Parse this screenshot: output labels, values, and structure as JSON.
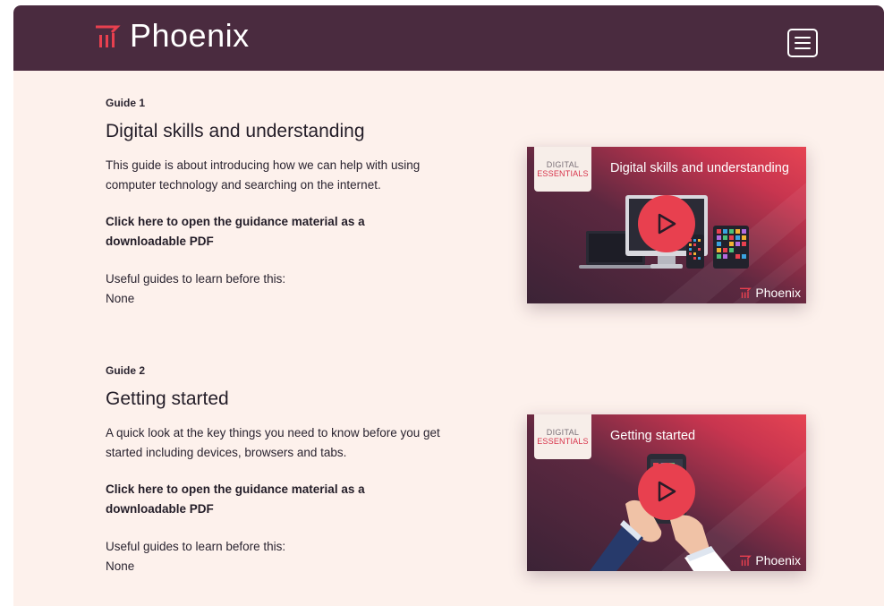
{
  "header": {
    "brand": "Phoenix",
    "menu_icon": "hamburger-menu-icon"
  },
  "colors": {
    "header_bg": "#4a2b3f",
    "page_bg": "#fdf1ec",
    "accent": "#e8404f"
  },
  "guides": [
    {
      "number": "Guide 1",
      "title": "Digital skills and understanding",
      "description": "This guide is about introducing how we can help with using computer technology and searching on the internet.",
      "link": "Click here to open the guidance material as a downloadable PDF",
      "prereq_label": "Useful guides to learn before this:",
      "prereq_value": "None",
      "video": {
        "badge_top": "DIGITAL",
        "badge_bottom": "ESSENTIALS",
        "title": "Digital skills and understanding",
        "brand": "Phoenix",
        "play_icon": "play-icon"
      }
    },
    {
      "number": "Guide 2",
      "title": "Getting started",
      "description": "A quick look at the key things you need to know before you get started including devices, browsers and tabs.",
      "link": "Click here to open the guidance material as a downloadable PDF",
      "prereq_label": "Useful guides to learn before this:",
      "prereq_value": "None",
      "video": {
        "badge_top": "DIGITAL",
        "badge_bottom": "ESSENTIALS",
        "title": "Getting started",
        "brand": "Phoenix",
        "play_icon": "play-icon"
      }
    }
  ]
}
